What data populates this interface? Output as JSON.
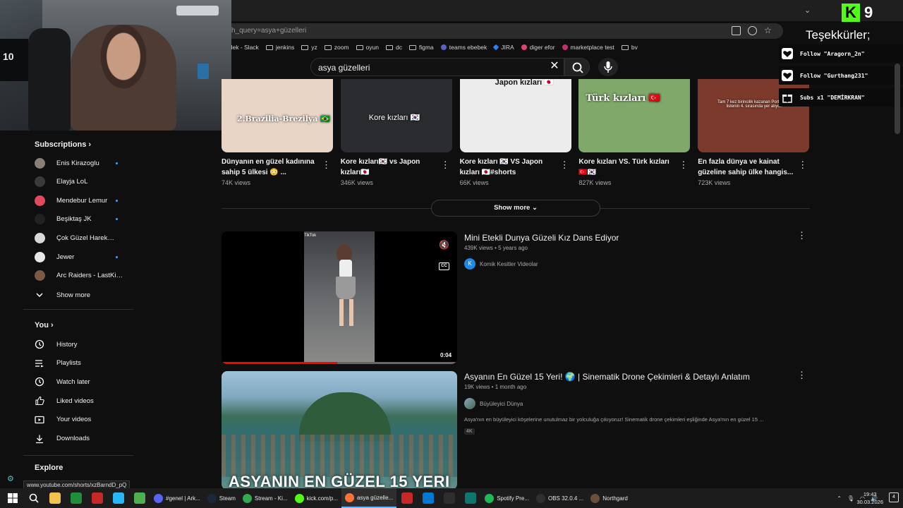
{
  "browser": {
    "url": "h_query=asya+güzelleri",
    "bookmarks": [
      "ozdilek - Slack",
      "jenkins",
      "yz",
      "zoom",
      "oyun",
      "dc",
      "figma",
      "teams ebebek",
      "JIRA",
      "diger efor",
      "marketplace test",
      "bv"
    ],
    "status_url": "www.youtube.com/shorts/xzBarndD_pQ"
  },
  "search": {
    "query": "asya güzelleri"
  },
  "sidebar": {
    "subscriptions_title": "Subscriptions",
    "subscriptions": [
      {
        "label": "Enis Kirazoglu",
        "live": true,
        "color": "#8a7f76"
      },
      {
        "label": "Elayja LoL",
        "live": false,
        "color": "#3a3a3a"
      },
      {
        "label": "Mendebur Lemur",
        "live": true,
        "color": "#e04a5c"
      },
      {
        "label": "Beşiktaş JK",
        "live": true,
        "color": "#222222"
      },
      {
        "label": "Çok Güzel Harek…",
        "live": false,
        "color": "#d8d8d8"
      },
      {
        "label": "Jewer",
        "live": true,
        "color": "#e8e8e8"
      },
      {
        "label": "Arc Raiders - LastKi…",
        "live": false,
        "color": "#7a5a44"
      }
    ],
    "show_more_label": "Show more",
    "you_title": "You",
    "you_items": [
      {
        "label": "History",
        "icon": "history-icon"
      },
      {
        "label": "Playlists",
        "icon": "playlists-icon"
      },
      {
        "label": "Watch later",
        "icon": "watch-later-icon"
      },
      {
        "label": "Liked videos",
        "icon": "liked-videos-icon"
      },
      {
        "label": "Your videos",
        "icon": "your-videos-icon"
      },
      {
        "label": "Downloads",
        "icon": "downloads-icon"
      }
    ],
    "explore_title": "Explore"
  },
  "shorts": [
    {
      "overlay": "2.Brazilia-Brezilya 🇧🇷",
      "title": "Dünyanın en güzel kadınına sahip 5 ülkesi 😳 ...",
      "views": "74K views",
      "bg": "#e9d5c6"
    },
    {
      "overlay": "Kore kızları 🇰🇷",
      "title": "Kore kızları🇰🇷 vs Japon kızları🇯🇵",
      "views": "346K views",
      "bg": "#2a2c30"
    },
    {
      "overlay": "Japon kızları 🇯🇵",
      "title": "Kore kızları 🇰🇷 VS Japon kızları 🇯🇵#shorts",
      "views": "66K views",
      "bg": "#ececec"
    },
    {
      "overlay": "Türk kızları 🇹🇷",
      "title": "Kore kızları VS. Türk kızları 🇹🇷🇰🇷",
      "views": "827K views",
      "bg": "#7fa86a"
    },
    {
      "overlay": "Tam 7 kez birincilik kazanan Porto Riko listenin 4. sırasında yer alıyor.",
      "title": "En fazla dünya ve kainat güzeline sahip ülke hangis...",
      "views": "723K views",
      "bg": "#7c3a2c"
    }
  ],
  "show_more_btn": "Show more",
  "videos": [
    {
      "title": "Mini Etekli Dunya Güzeli Kız Dans Ediyor",
      "meta": "439K views • 5 years ago",
      "channel": "Komik Kesitler Videolar",
      "channel_initial": "K",
      "duration": "0:04",
      "progress": 0.49
    },
    {
      "title": "Asyanın En Güzel 15 Yeri! 🌍 | Sinematik Drone Çekimleri & Detaylı Anlatım",
      "meta": "19K views • 1 month ago",
      "channel": "Büyüleyici Dünya",
      "description": "Asya'nın en büyüleyici köşelerine unutulmaz bir yolculuğa çıkıyoruz! Sinematik drone çekimleri eşliğinde Asya'nın en güzel 15 ...",
      "badge": "4K",
      "thumb_text": "ASYANIN EN GÜZEL 15 YERI"
    }
  ],
  "overlay": {
    "kick_number": "9",
    "thanks": "Teşekkürler;",
    "alerts": [
      {
        "text": "Follow \"Aragorn_2n\"",
        "icon": "heart-icon"
      },
      {
        "text": "Follow \"Gurthang231\"",
        "icon": "heart-icon"
      },
      {
        "text": "Subs x1 \"DEMİRKRAN\"",
        "icon": "gift-icon"
      }
    ]
  },
  "taskbar": {
    "apps": [
      {
        "label": "#genel | Ark...",
        "color": "#5865f2"
      },
      {
        "label": "Steam",
        "color": "#1b2838"
      },
      {
        "label": "Stream - Ki...",
        "color": "#34a853"
      },
      {
        "label": "kick.com/p...",
        "color": "#53fc18"
      },
      {
        "label": "asya güzelle...",
        "color": "#ff7139",
        "active": true
      },
      {
        "label": "Spotify Pre...",
        "color": "#1db954"
      },
      {
        "label": "OBS 32.0.4 ...",
        "color": "#302e31"
      },
      {
        "label": "Northgard",
        "color": "#6b4f3a"
      }
    ],
    "time": "19:43",
    "date": "30.03.2026",
    "notifications": "4"
  }
}
